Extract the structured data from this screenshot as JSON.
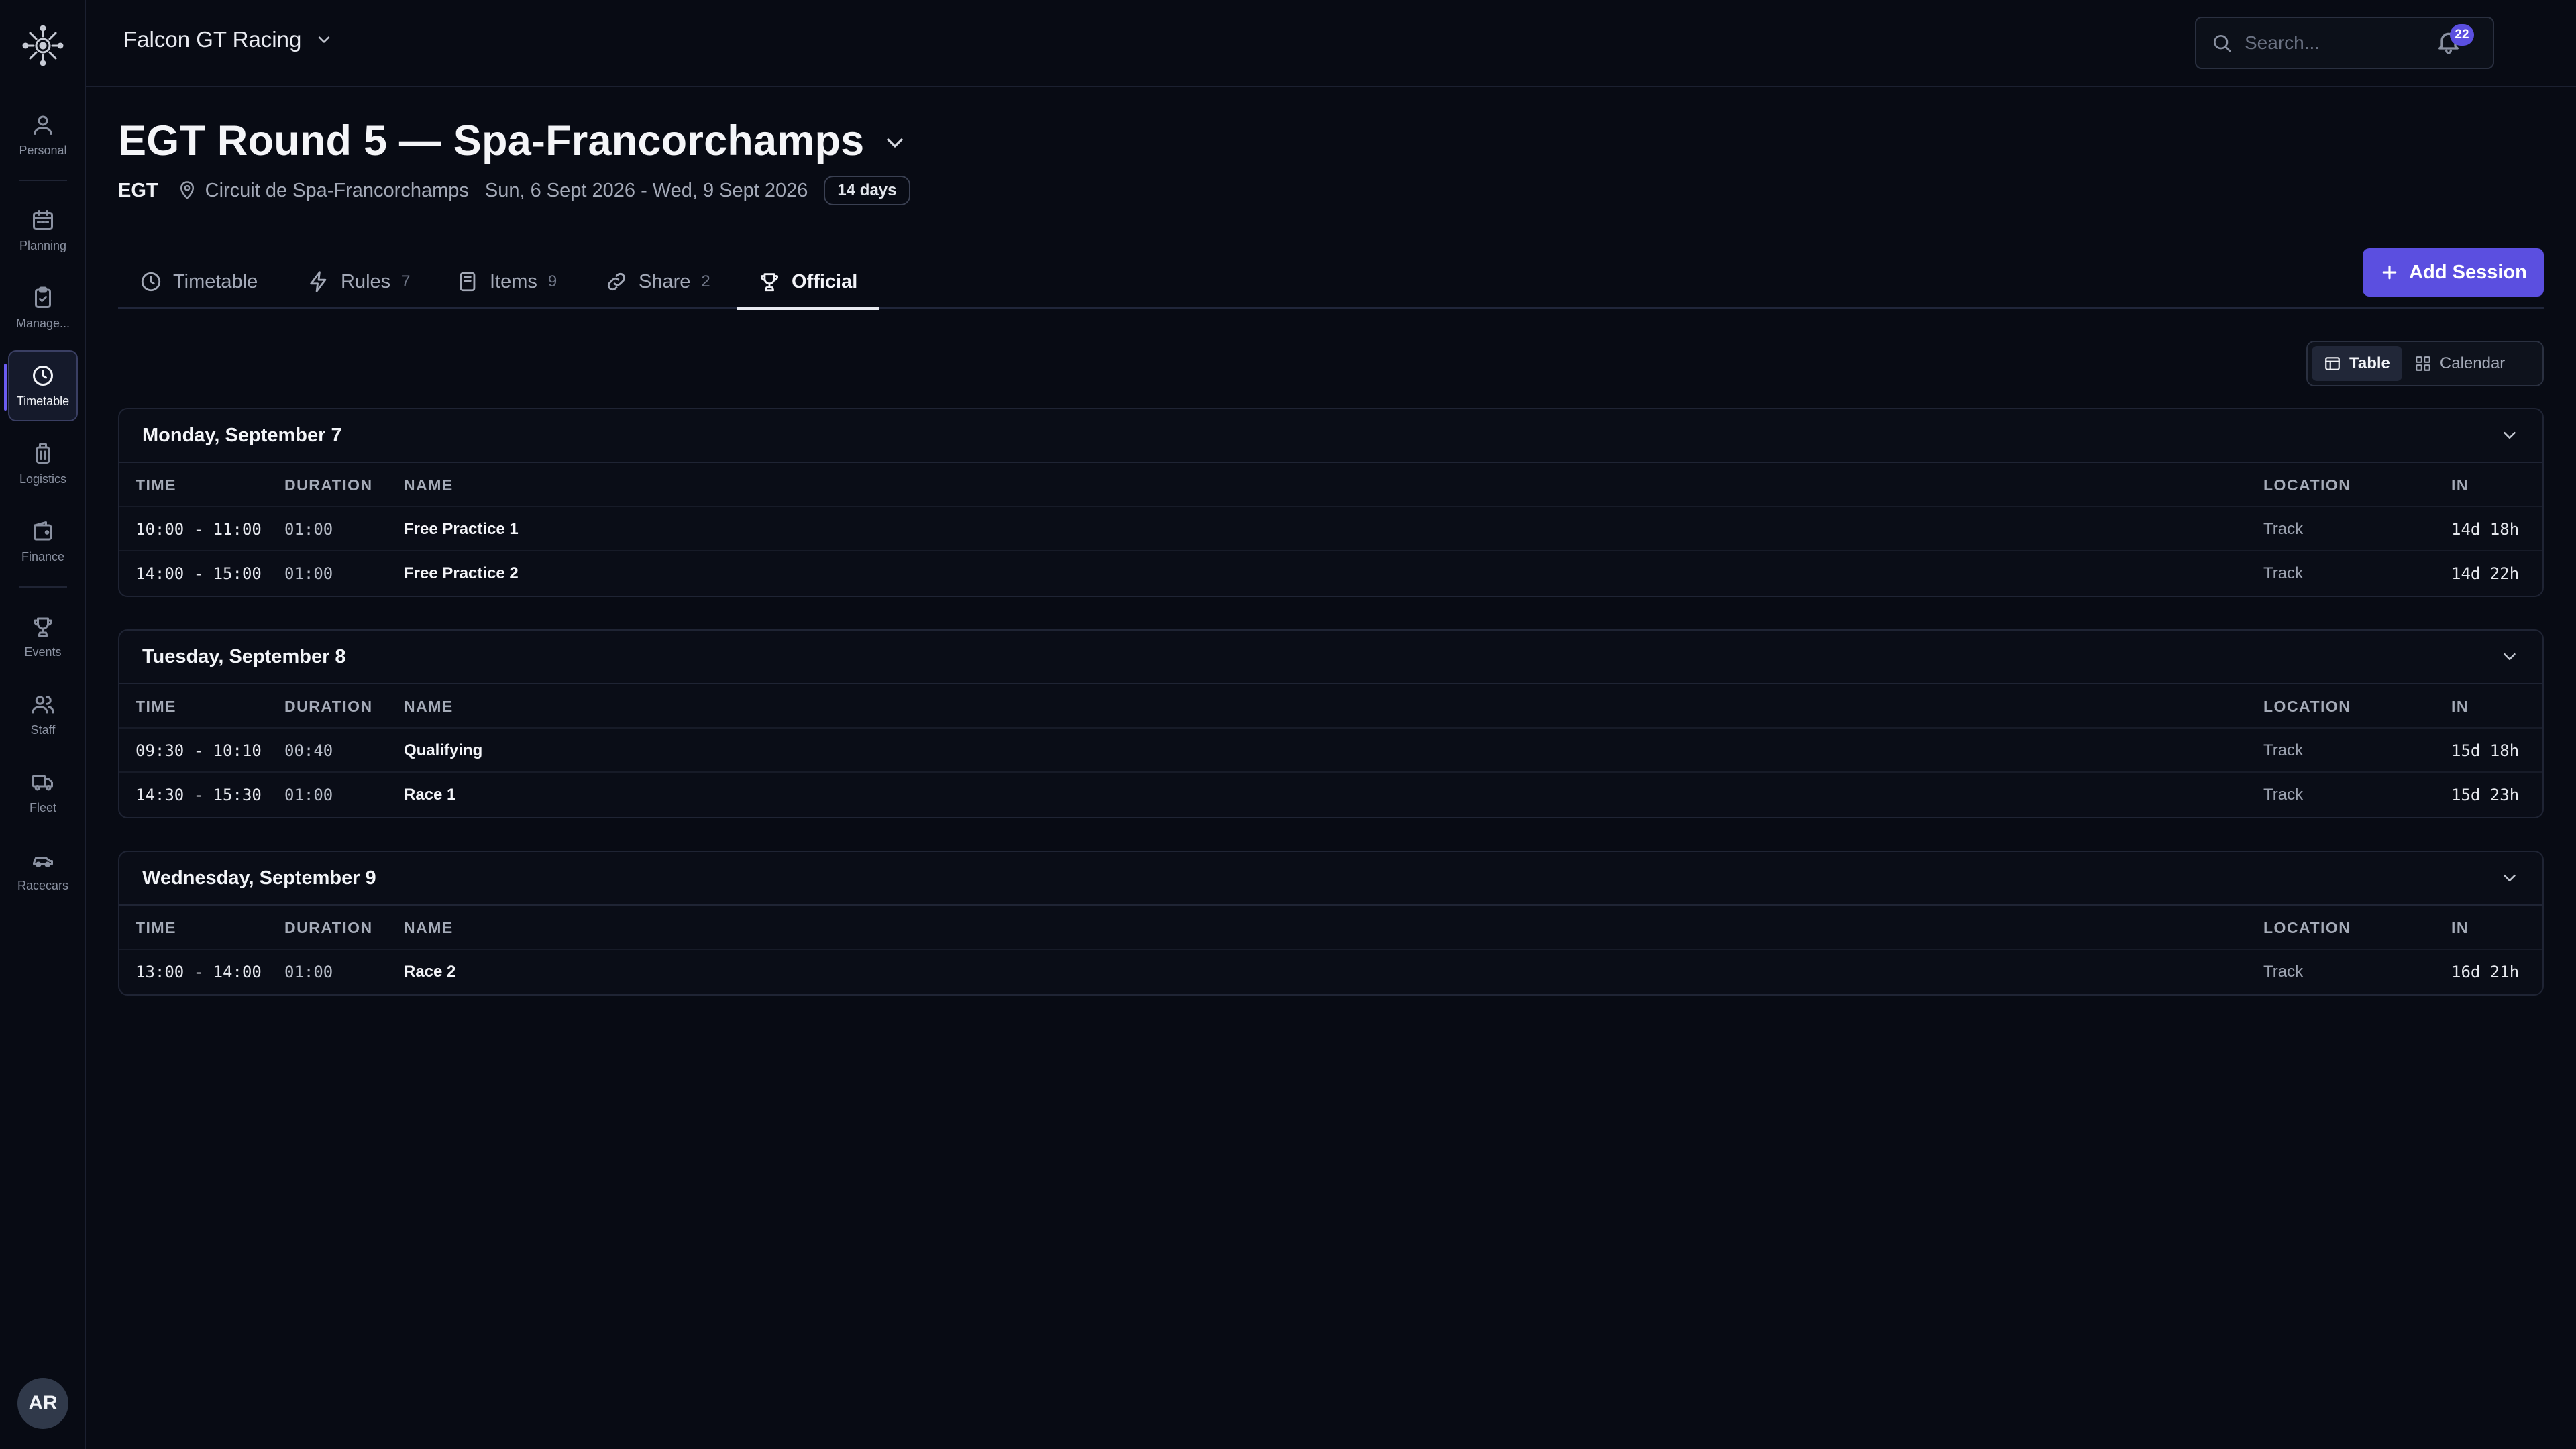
{
  "topbar": {
    "org_name": "Falcon GT Racing",
    "search_placeholder": "Search...",
    "notification_count": "22"
  },
  "sidebar": {
    "items": [
      {
        "label": "Personal",
        "icon": "user-icon"
      },
      {
        "label": "Planning",
        "icon": "calendar-icon"
      },
      {
        "label": "Manage...",
        "icon": "clipboard-check-icon"
      },
      {
        "label": "Timetable",
        "icon": "clock-icon",
        "active": true
      },
      {
        "label": "Logistics",
        "icon": "luggage-icon"
      },
      {
        "label": "Finance",
        "icon": "wallet-icon"
      },
      {
        "label": "Events",
        "icon": "trophy-icon"
      },
      {
        "label": "Staff",
        "icon": "users-icon"
      },
      {
        "label": "Fleet",
        "icon": "truck-icon"
      },
      {
        "label": "Racecars",
        "icon": "car-icon"
      }
    ],
    "avatar_initials": "AR"
  },
  "event": {
    "title": "EGT Round 5 — Spa-Francorchamps",
    "series": "EGT",
    "location": "Circuit de Spa-Francorchamps",
    "dates": "Sun, 6 Sept 2026 - Wed, 9 Sept 2026",
    "countdown_badge": "14 days"
  },
  "tabs": [
    {
      "label": "Timetable",
      "count": "",
      "icon": "clock-icon"
    },
    {
      "label": "Rules",
      "count": "7",
      "icon": "lightning-icon"
    },
    {
      "label": "Items",
      "count": "9",
      "icon": "book-icon"
    },
    {
      "label": "Share",
      "count": "2",
      "icon": "link-icon"
    },
    {
      "label": "Official",
      "count": "",
      "icon": "trophy-icon",
      "active": true
    }
  ],
  "actions": {
    "add_session": "Add Session"
  },
  "view_toggle": {
    "table": "Table",
    "calendar": "Calendar",
    "selected": "Table"
  },
  "columns": {
    "time": "TIME",
    "duration": "DURATION",
    "name": "NAME",
    "location": "LOCATION",
    "in": "IN"
  },
  "days": [
    {
      "title": "Monday, September 7",
      "sessions": [
        {
          "time": "10:00 - 11:00",
          "duration": "01:00",
          "name": "Free Practice 1",
          "location": "Track",
          "in": "14d 18h"
        },
        {
          "time": "14:00 - 15:00",
          "duration": "01:00",
          "name": "Free Practice 2",
          "location": "Track",
          "in": "14d 22h"
        }
      ]
    },
    {
      "title": "Tuesday, September 8",
      "sessions": [
        {
          "time": "09:30 - 10:10",
          "duration": "00:40",
          "name": "Qualifying",
          "location": "Track",
          "in": "15d 18h"
        },
        {
          "time": "14:30 - 15:30",
          "duration": "01:00",
          "name": "Race 1",
          "location": "Track",
          "in": "15d 23h"
        }
      ]
    },
    {
      "title": "Wednesday, September 9",
      "sessions": [
        {
          "time": "13:00 - 14:00",
          "duration": "01:00",
          "name": "Race 2",
          "location": "Track",
          "in": "16d 21h"
        }
      ]
    }
  ],
  "colors": {
    "accent": "#5b4fe0",
    "background": "#080b14",
    "border": "#1f2434"
  }
}
